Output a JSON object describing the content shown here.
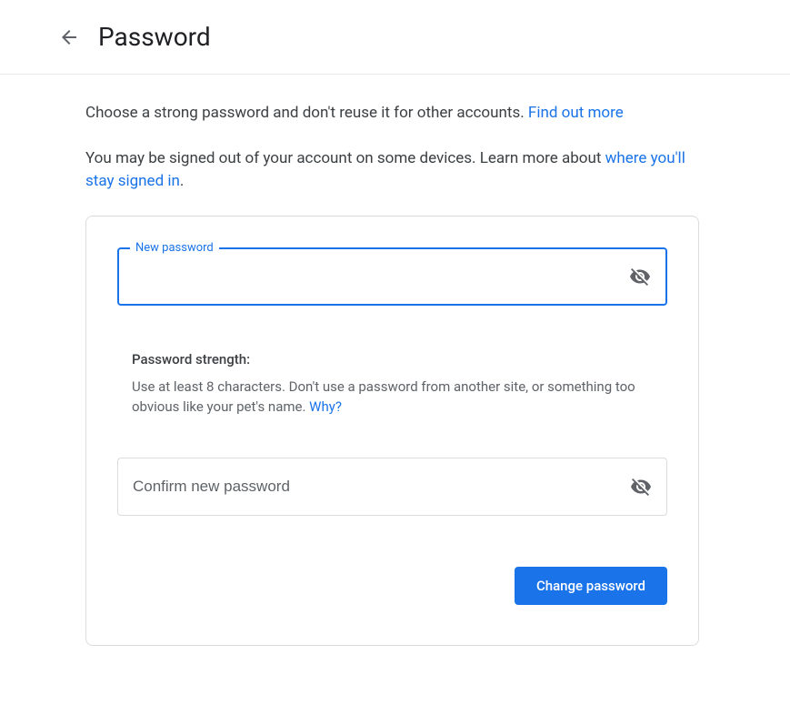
{
  "header": {
    "title": "Password"
  },
  "intro": {
    "para1_text": "Choose a strong password and don't reuse it for other accounts. ",
    "para1_link": "Find out more",
    "para2_prefix": "You may be signed out of your account on some devices. Learn more about ",
    "para2_link": "where you'll stay signed in",
    "para2_suffix": "."
  },
  "form": {
    "new_password_label": "New password",
    "new_password_value": "",
    "confirm_placeholder": "Confirm new password",
    "confirm_value": "",
    "strength_title": "Password strength:",
    "strength_hint_text": "Use at least 8 characters. Don't use a password from another site, or something too obvious like your pet's name. ",
    "strength_why_link": "Why?",
    "submit_label": "Change password"
  }
}
